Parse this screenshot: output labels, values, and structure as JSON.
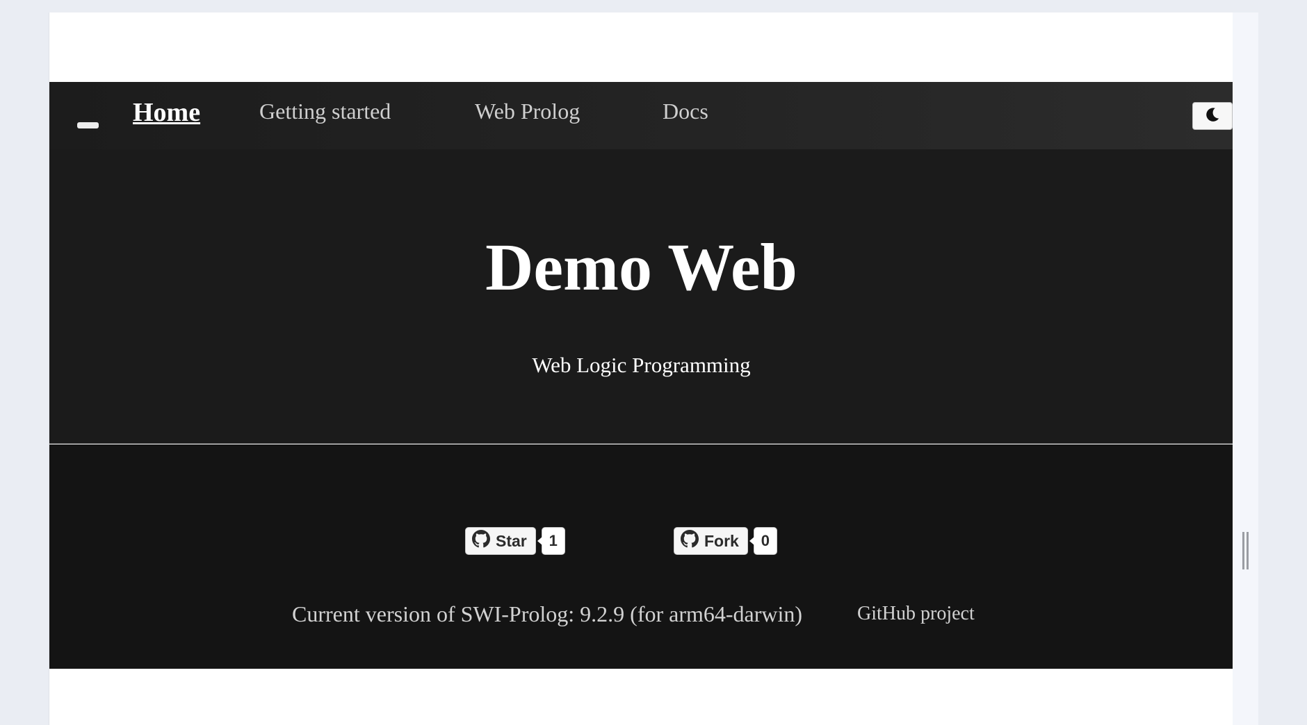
{
  "nav": {
    "items": [
      {
        "label": "Home",
        "active": true
      },
      {
        "label": "Getting started",
        "active": false
      },
      {
        "label": "Web Prolog",
        "active": false
      },
      {
        "label": "Docs",
        "active": false
      }
    ],
    "menu_icon": "minus-icon",
    "theme_icon": "moon-icon"
  },
  "hero": {
    "title": "Demo Web",
    "subtitle": "Web Logic Programming"
  },
  "footer": {
    "star": {
      "label": "Star",
      "count": "1",
      "icon": "github-icon"
    },
    "fork": {
      "label": "Fork",
      "count": "0",
      "icon": "github-icon"
    },
    "version": "Current version of SWI-Prolog: 9.2.9 (for arm64-darwin)",
    "github_link": "GitHub project"
  },
  "colors": {
    "nav_bg": "#1c1c1c",
    "hero_bg": "#1b1b1b",
    "footer_bg": "#141414",
    "page_bg": "#eaedf3"
  }
}
